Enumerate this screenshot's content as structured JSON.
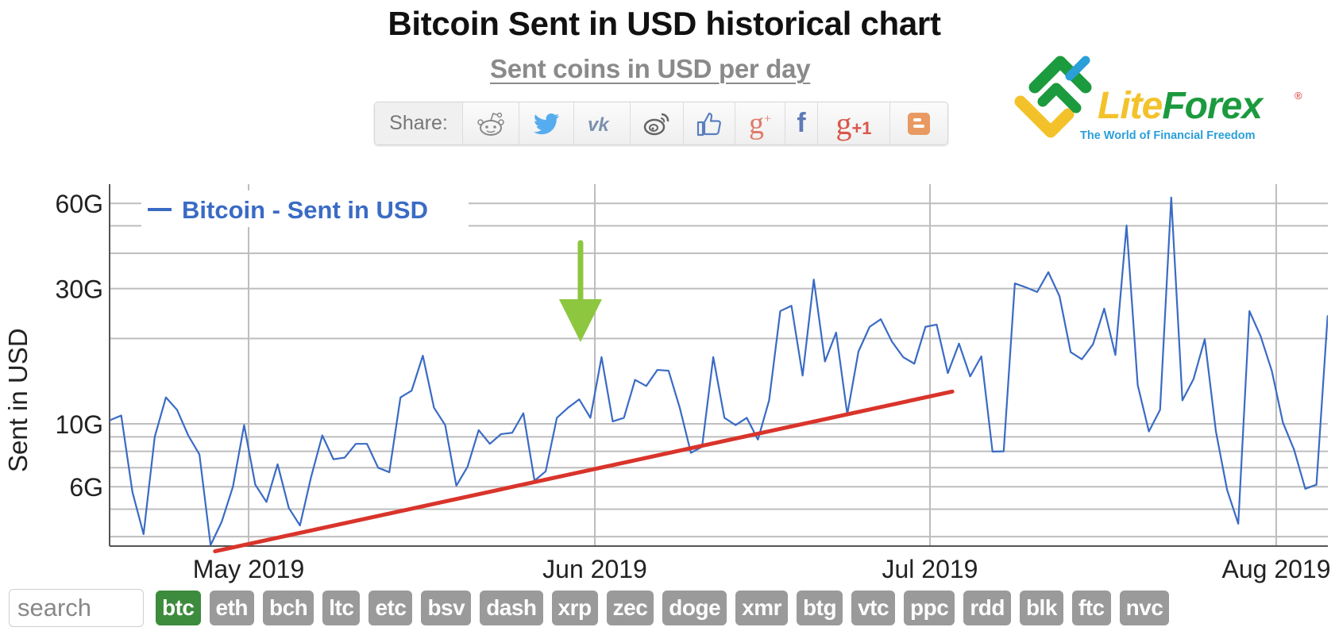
{
  "header": {
    "title": "Bitcoin Sent in USD historical chart",
    "subtitle": "Sent coins in USD per day"
  },
  "share": {
    "label": "Share:",
    "buttons": [
      {
        "name": "reddit",
        "icon": "reddit-icon",
        "color": "#888888"
      },
      {
        "name": "twitter",
        "icon": "twitter-icon",
        "color": "#55acee"
      },
      {
        "name": "vk",
        "icon": "vk-icon",
        "color": "#7c91ad"
      },
      {
        "name": "weibo",
        "icon": "weibo-icon",
        "color": "#666666"
      },
      {
        "name": "like",
        "icon": "thumbs-up-icon",
        "color": "#5a7fbf"
      },
      {
        "name": "google-plus",
        "icon": "google-plus-icon",
        "color": "#e07a6a"
      },
      {
        "name": "facebook",
        "icon": "facebook-icon",
        "color": "#5d7ab5"
      },
      {
        "name": "google-plus-one",
        "icon": "google-plus-one-icon",
        "color": "#d9574a",
        "text": "g+1"
      },
      {
        "name": "blogger",
        "icon": "blogger-icon",
        "color": "#e89a62"
      }
    ]
  },
  "logo": {
    "brand_part1": "Lite",
    "brand_part2": "Forex",
    "registered": "®",
    "tagline": "The World of Financial Freedom",
    "colors": {
      "green": "#1c9a3e",
      "yellow": "#f3c22b",
      "blue": "#2a9fd8"
    }
  },
  "annotations": {
    "arrow_color": "#8dc63f",
    "arrow_points_to_date": "2019-05-31",
    "trendline_color": "#d9342b",
    "trendline": {
      "start_date": "2019-04-28",
      "start_value": 3.55,
      "end_date": "2019-07-03",
      "end_value": 13.0
    }
  },
  "search": {
    "placeholder": "search",
    "value": ""
  },
  "coins": {
    "active": "btc",
    "active_color": "#3d8b3d",
    "inactive_color": "#9a9a9a",
    "items": [
      "btc",
      "eth",
      "bch",
      "ltc",
      "etc",
      "bsv",
      "dash",
      "xrp",
      "zec",
      "doge",
      "xmr",
      "btg",
      "vtc",
      "ppc",
      "rdd",
      "blk",
      "ftc",
      "nvc"
    ]
  },
  "chart_data": {
    "type": "line",
    "title": "Bitcoin Sent in USD historical chart",
    "subtitle": "Sent coins in USD per day",
    "xlabel": "",
    "ylabel": "Sent in USD",
    "yscale": "log",
    "units": "G (billions USD)",
    "ylim": [
      3.7,
      66
    ],
    "yticks": [
      {
        "value": 6,
        "label": "6G"
      },
      {
        "value": 10,
        "label": "10G"
      },
      {
        "value": 30,
        "label": "30G"
      },
      {
        "value": 60,
        "label": "60G"
      }
    ],
    "ygrid": [
      4,
      5,
      6,
      7,
      8,
      9,
      10,
      20,
      30,
      40,
      50,
      60
    ],
    "xticks": [
      {
        "date": "2019-05-01",
        "label": "May 2019"
      },
      {
        "date": "2019-06-01",
        "label": "Jun 2019"
      },
      {
        "date": "2019-07-01",
        "label": "Jul 2019"
      },
      {
        "date": "2019-08-01",
        "label": "Aug 2019"
      }
    ],
    "xlim": [
      "2019-04-18",
      "2019-08-05"
    ],
    "grid": true,
    "legend": {
      "position": "top-left",
      "entries": [
        {
          "label": "Bitcoin - Sent in USD",
          "color": "#3a6bc4"
        }
      ]
    },
    "series": [
      {
        "name": "Bitcoin - Sent in USD",
        "color": "#3a6bc4",
        "start_date": "2019-04-18",
        "interval": "1 day",
        "values": [
          10.3,
          10.7,
          5.75,
          4.08,
          9.0,
          12.4,
          11.2,
          9.1,
          7.8,
          3.73,
          4.52,
          6.0,
          9.9,
          6.1,
          5.3,
          7.2,
          5.05,
          4.38,
          6.5,
          9.1,
          7.5,
          7.6,
          8.5,
          8.5,
          7.0,
          6.75,
          12.4,
          13.1,
          17.4,
          11.4,
          9.9,
          6.05,
          7.05,
          9.5,
          8.5,
          9.2,
          9.3,
          10.9,
          6.3,
          6.8,
          10.5,
          11.4,
          12.2,
          10.5,
          17.2,
          10.2,
          10.5,
          14.3,
          13.6,
          15.5,
          15.4,
          11.4,
          7.9,
          8.3,
          17.2,
          10.5,
          9.9,
          10.5,
          8.8,
          12.1,
          25.0,
          26.1,
          14.8,
          32.3,
          16.6,
          21.0,
          10.8,
          18.0,
          22.0,
          23.4,
          19.5,
          17.2,
          16.3,
          22.0,
          22.4,
          15.1,
          19.2,
          14.7,
          17.3,
          7.98,
          8.0,
          31.3,
          30.3,
          29.2,
          34.3,
          28.2,
          17.9,
          16.9,
          19.1,
          25.5,
          17.5,
          50.1,
          13.7,
          9.4,
          11.2,
          62.9,
          12.1,
          14.4,
          19.9,
          9.4,
          5.85,
          4.44,
          25.0,
          20.4,
          15.4,
          10.1,
          8.1,
          5.9,
          6.1,
          24.0,
          21.1
        ]
      }
    ]
  }
}
